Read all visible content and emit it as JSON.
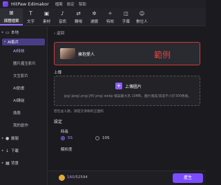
{
  "app": {
    "title": "HitPaw Edimakor",
    "menu": [
      "檔案",
      "設定",
      "幫助"
    ]
  },
  "toolbar": {
    "items": [
      {
        "icon": "⊞",
        "label": "媒體檔案",
        "active": true
      },
      {
        "icon": "T",
        "label": "文字"
      },
      {
        "icon": "▣",
        "label": "素材"
      },
      {
        "icon": "♪",
        "label": "音訊"
      },
      {
        "icon": "⇄",
        "label": "轉場"
      },
      {
        "icon": "✲",
        "label": "濾鏡"
      },
      {
        "icon": "✧",
        "label": "特效"
      },
      {
        "icon": "◫",
        "label": "字幕"
      },
      {
        "icon": "☺",
        "label": "數位人"
      }
    ]
  },
  "sidebar": {
    "local": "本地",
    "ai_video": "AI影片",
    "items": [
      "AI特效",
      "圖片產生影片",
      "文生影片",
      "AI動畫",
      "AI轉繪",
      "換臉",
      "我的創作"
    ],
    "record": "錄製",
    "download": "下載",
    "background": "背景"
  },
  "main": {
    "back": "返回",
    "example_title": "擁抱愛人",
    "example_tag": "範例",
    "upload_label": "上傳",
    "upload_button": "上傳圖片",
    "upload_hint": "jpg/.jpeg/.png/.jfif/.png/.webp 檔案最大為 10MB，圖片寬度/高度不小於300像素。",
    "note": "若包含人臉，請提交清晰的正面照",
    "settings": "設定",
    "duration_label": "時長",
    "duration_opt1": "5S",
    "duration_opt2": "10S",
    "resolution_label": "解析度"
  },
  "footer": {
    "credits_used": "160",
    "credits_total": "/52594",
    "generate": "產生"
  }
}
